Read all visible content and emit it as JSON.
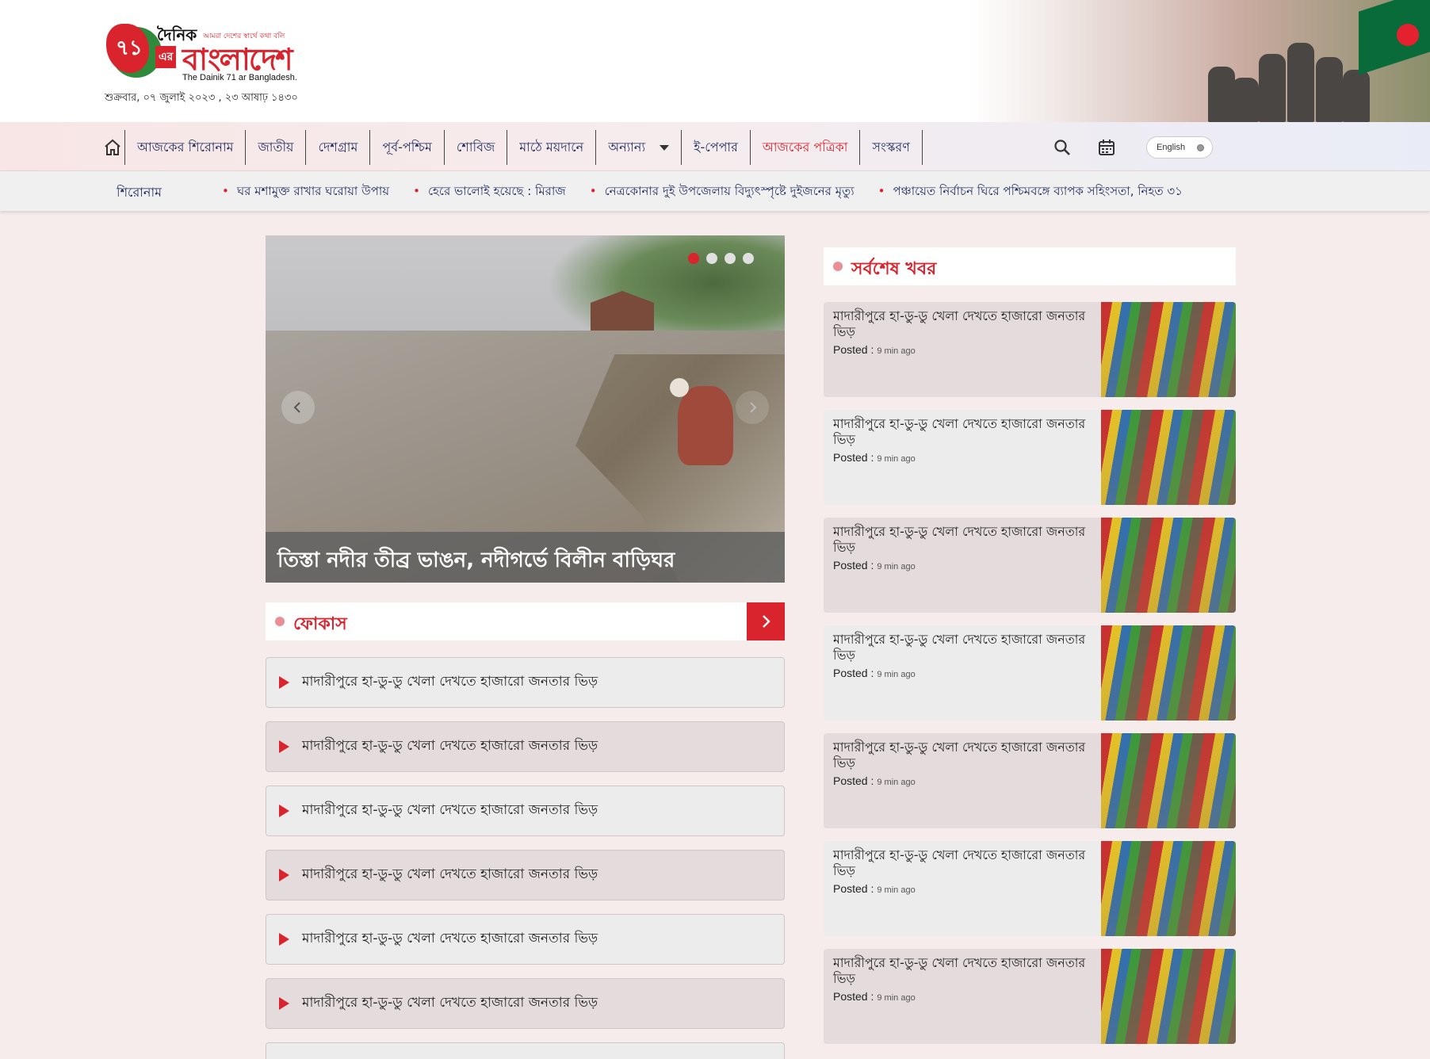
{
  "header": {
    "logo_number": "৭১",
    "logo_dainik": "দৈনিক",
    "logo_tagline": "আমরা দেশের স্বার্থে কথা বলি",
    "logo_er": "এর",
    "logo_bangladesh": "বাংলাদেশ",
    "logo_english": "The Dainik 71 ar Bangladesh.",
    "date": "শুক্রবার, ০৭ জুলাই ২০২৩ , ২৩ আষাঢ় ১৪৩০"
  },
  "nav": {
    "items": [
      {
        "label": "আজকের শিরোনাম"
      },
      {
        "label": "জাতীয়"
      },
      {
        "label": "দেশগ্রাম"
      },
      {
        "label": "পূর্ব-পশ্চিম"
      },
      {
        "label": "শোবিজ"
      },
      {
        "label": "মাঠে ময়দানে"
      },
      {
        "label": "অন্যান্য"
      },
      {
        "label": "ই-পেপার"
      },
      {
        "label": "আজকের পত্রিকা"
      },
      {
        "label": "সংস্করণ"
      }
    ],
    "language_toggle": "English",
    "icons": {
      "home": "home-icon",
      "search": "search-icon",
      "calendar": "calendar-icon"
    }
  },
  "ticker": {
    "label": "শিরোনাম",
    "items": [
      "ঘর মশামুক্ত রাখার ঘরোয়া উপায়",
      "হেরে ভালোই হয়েছে : মিরাজ",
      "নেত্রকোনার দুই উপজেলায় বিদ্যুৎস্পৃষ্টে দুইজনের মৃত্যু",
      "পঞ্চায়েত নির্বাচন ঘিরে পশ্চিমবঙ্গে ব্যাপক সহিংসতা, নিহত ৩১"
    ]
  },
  "slider": {
    "caption": "তিস্তা নদীর তীব্র ভাঙন, নদীগর্ভে বিলীন বাড়িঘর",
    "slide_count": 4,
    "active_slide": 1
  },
  "focus": {
    "title": "ফোকাস",
    "items": [
      "মাদারীপুরে হা-ডু-ডু খেলা দেখতে হাজারো জনতার ভিড়",
      "মাদারীপুরে হা-ডু-ডু খেলা দেখতে হাজারো জনতার ভিড়",
      "মাদারীপুরে হা-ডু-ডু খেলা দেখতে হাজারো জনতার ভিড়",
      "মাদারীপুরে হা-ডু-ডু খেলা দেখতে হাজারো জনতার ভিড়",
      "মাদারীপুরে হা-ডু-ডু খেলা দেখতে হাজারো জনতার ভিড়",
      "মাদারীপুরে হা-ডু-ডু খেলা দেখতে হাজারো জনতার ভিড়"
    ]
  },
  "latest": {
    "title": "সর্বশেষ খবর",
    "items": [
      {
        "title": "মাদারীপুরে হা-ডু-ডু খেলা দেখতে হাজারো জনতার ভিড়",
        "posted_label": "Posted :",
        "time": "9 min ago"
      },
      {
        "title": "মাদারীপুরে হা-ডু-ডু খেলা দেখতে হাজারো জনতার ভিড়",
        "posted_label": "Posted :",
        "time": "9 min ago"
      },
      {
        "title": "মাদারীপুরে হা-ডু-ডু খেলা দেখতে হাজারো জনতার ভিড়",
        "posted_label": "Posted :",
        "time": "9 min ago"
      },
      {
        "title": "মাদারীপুরে হা-ডু-ডু খেলা দেখতে হাজারো জনতার ভিড়",
        "posted_label": "Posted :",
        "time": "9 min ago"
      },
      {
        "title": "মাদারীপুরে হা-ডু-ডু খেলা দেখতে হাজারো জনতার ভিড়",
        "posted_label": "Posted :",
        "time": "9 min ago"
      },
      {
        "title": "মাদারীপুরে হা-ডু-ডু খেলা দেখতে হাজারো জনতার ভিড়",
        "posted_label": "Posted :",
        "time": "9 min ago"
      },
      {
        "title": "মাদারীপুরে হা-ডু-ডু খেলা দেখতে হাজারো জনতার ভিড়",
        "posted_label": "Posted :",
        "time": "9 min ago"
      }
    ]
  },
  "colors": {
    "accent": "#d9232d",
    "nav_text": "#1e2a5a",
    "section_dot": "#e98f98"
  }
}
